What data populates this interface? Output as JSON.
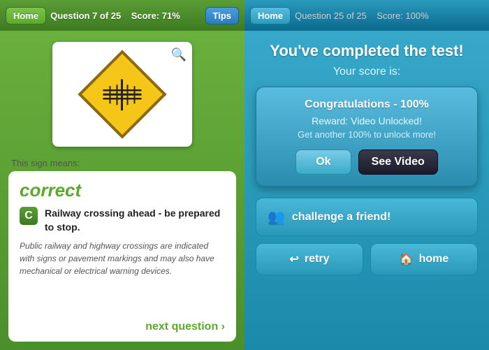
{
  "left": {
    "home_btn": "Home",
    "question_info": "Question 7 of 25",
    "score_info": "Score: 71%",
    "tips_btn": "Tips",
    "sign_label": "This sign means:",
    "correct_label": "correct",
    "answer_letter": "C",
    "answer_text": "Railway crossing ahead - be prepared to stop.",
    "explanation": "Public railway and highway crossings are indicated with signs or pavement markings and may also have mechanical or electrical warning devices.",
    "next_btn": "next question ›"
  },
  "right": {
    "home_btn": "Home",
    "question_info": "Question 25 of 25",
    "score_info": "Score: 100%",
    "completion_title": "You've completed the test!",
    "score_label": "Your score is:",
    "congrats_title": "Congratulations - 100%",
    "reward_text": "Reward: Video Unlocked!",
    "unlock_more": "Get another 100% to unlock more!",
    "ok_btn": "Ok",
    "see_video_btn": "See Video",
    "challenge_btn": "challenge a friend!",
    "retry_btn": "retry",
    "home_btn2": "home"
  }
}
